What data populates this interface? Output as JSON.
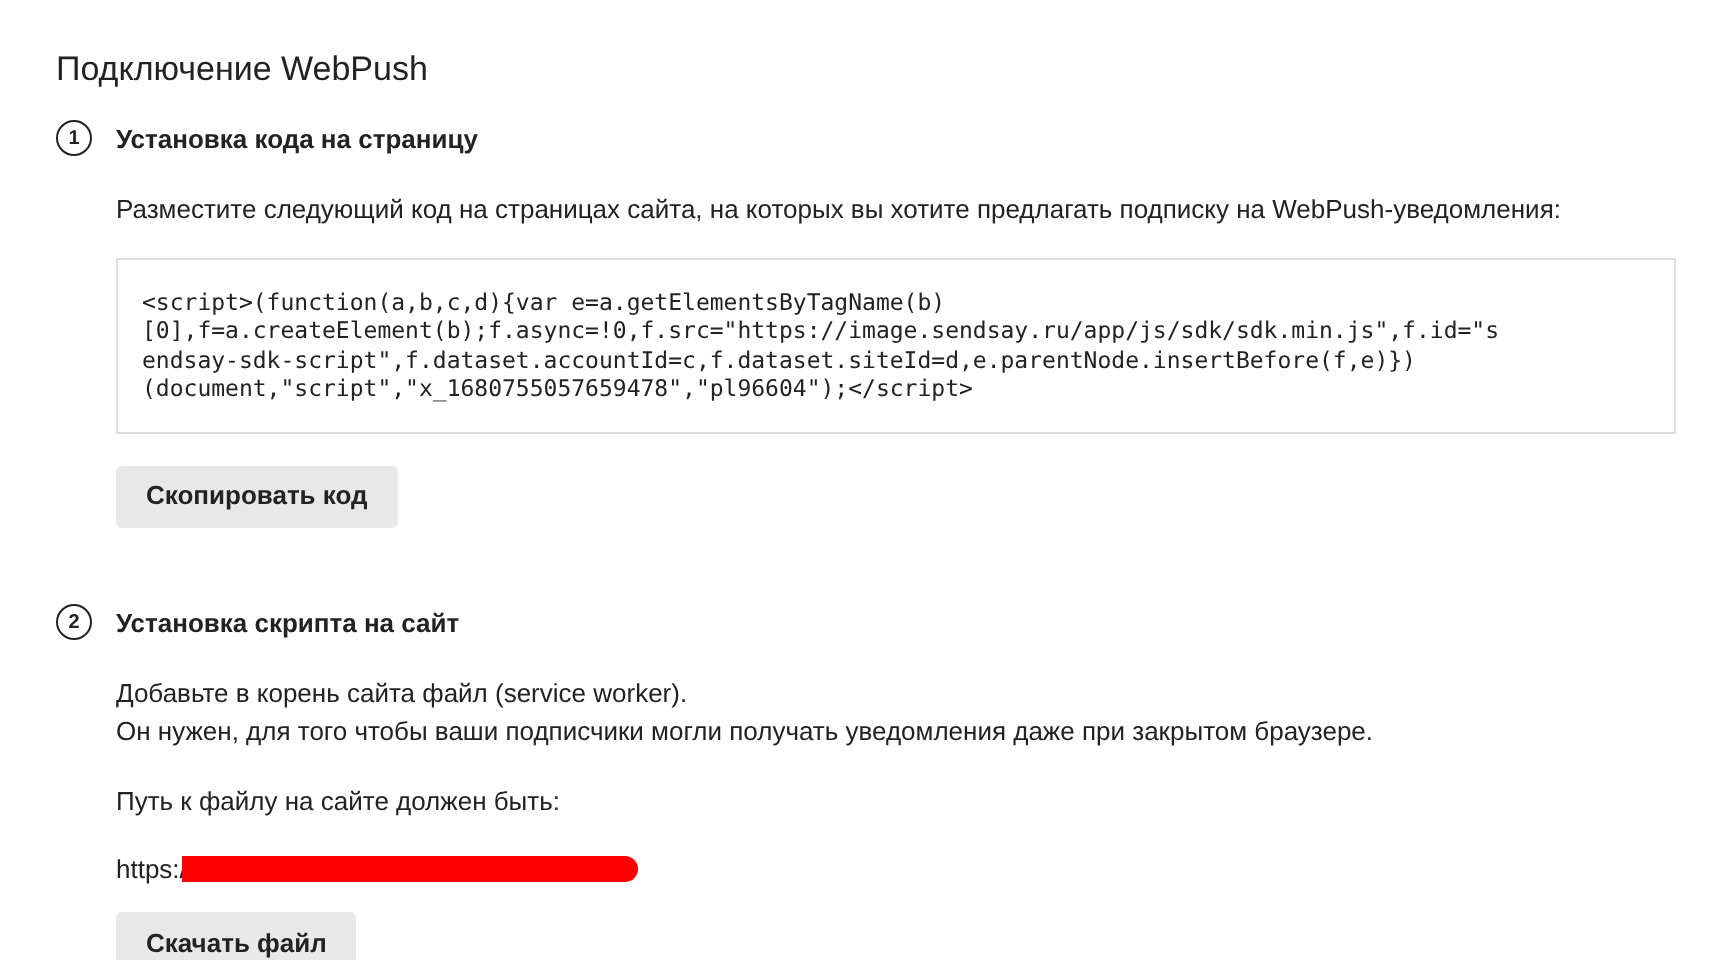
{
  "title": "Подключение WebPush",
  "steps": [
    {
      "number": "1",
      "heading": "Установка кода на страницу",
      "blocks": [
        {
          "kind": "text",
          "text": "Разместите следующий код на страницах сайта, на которых вы хотите предлагать подписку на WebPush-уведомления:"
        },
        {
          "kind": "code",
          "lines": [
            "<script>(function(a,b,c,d){var e=a.getElementsByTagName(b)",
            "[0],f=a.createElement(b);f.async=!0,f.src=\"https://image.sendsay.ru/app/js/sdk/sdk.min.js\",f.id=\"s",
            "endsay-sdk-script\",f.dataset.accountId=c,f.dataset.siteId=d,e.parentNode.insertBefore(f,e)})",
            "(document,\"script\",\"x_1680755057659478\",\"pl96604\");</script>"
          ]
        },
        {
          "kind": "button",
          "label": "Скопировать код"
        }
      ]
    },
    {
      "number": "2",
      "heading": "Установка скрипта на сайт",
      "blocks": [
        {
          "kind": "lines",
          "lines": [
            "Добавьте в корень сайта файл (service worker).",
            "Он нужен, для того чтобы ваши подписчики могли получать уведомления даже при закрытом браузере."
          ]
        },
        {
          "kind": "text",
          "text": "Путь к файлу на сайте должен быть:"
        },
        {
          "kind": "redacted",
          "text": "https:/"
        },
        {
          "kind": "button",
          "label": "Скачать файл"
        }
      ]
    }
  ]
}
